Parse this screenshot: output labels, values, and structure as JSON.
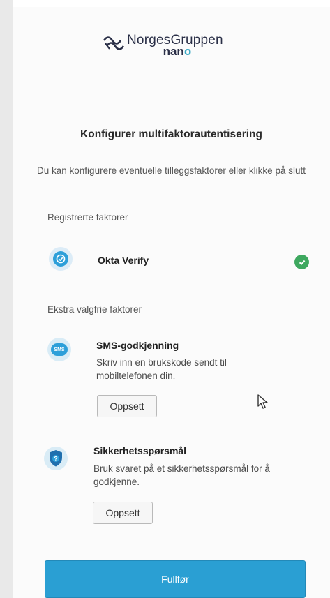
{
  "brand": {
    "name": "NorgesGruppen",
    "sub_prefix": "nan",
    "sub_suffix": "o"
  },
  "page": {
    "title": "Konfigurer multifaktorautentisering",
    "subtitle": "Du kan konfigurere eventuelle tilleggsfaktorer eller klikke på slutt"
  },
  "registered": {
    "label": "Registrerte faktorer",
    "factors": [
      {
        "name": "Okta Verify",
        "icon": "okta-verify-icon",
        "status": "check-icon"
      }
    ]
  },
  "optional": {
    "label": "Ekstra valgfrie faktorer",
    "factors": [
      {
        "name": "SMS-godkjenning",
        "icon": "sms-icon",
        "icon_text": "SMS",
        "description": "Skriv inn en brukskode sendt til mobiltelefonen din.",
        "button": "Oppsett"
      },
      {
        "name": "Sikkerhetsspørsmål",
        "icon": "security-question-icon",
        "icon_text": "?",
        "description": "Bruk svaret på et sikkerhetsspørsmål for å godkjenne.",
        "button": "Oppsett"
      }
    ]
  },
  "actions": {
    "finish": "Fullfør"
  },
  "colors": {
    "primary": "#2a9fd3",
    "success": "#3ea85f",
    "icon_bg": "#d9ecf6"
  }
}
